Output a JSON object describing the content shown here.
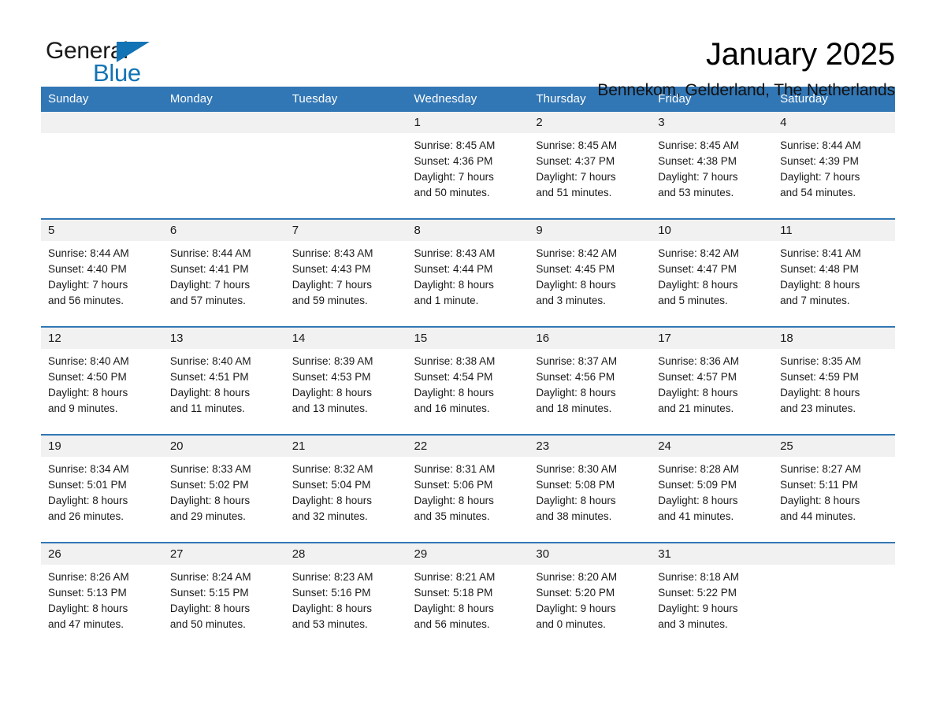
{
  "brand": {
    "name_top": "General",
    "name_bottom": "Blue",
    "accent_color": "#1273b5"
  },
  "header": {
    "title": "January 2025",
    "location": "Bennekom, Gelderland, The Netherlands"
  },
  "theme": {
    "header_blue": "#3277b5",
    "daynum_band": "#f1f1f1",
    "text": "#1a1a1a"
  },
  "weekday_headers": [
    "Sunday",
    "Monday",
    "Tuesday",
    "Wednesday",
    "Thursday",
    "Friday",
    "Saturday"
  ],
  "labels": {
    "sunrise_prefix": "Sunrise:",
    "sunset_prefix": "Sunset:",
    "daylight_prefix": "Daylight:"
  },
  "weeks": [
    [
      {
        "day": "",
        "empty": true
      },
      {
        "day": "",
        "empty": true
      },
      {
        "day": "",
        "empty": true
      },
      {
        "day": "1",
        "sunrise": "Sunrise: 8:45 AM",
        "sunset": "Sunset: 4:36 PM",
        "daylight_line1": "Daylight: 7 hours",
        "daylight_line2": "and 50 minutes."
      },
      {
        "day": "2",
        "sunrise": "Sunrise: 8:45 AM",
        "sunset": "Sunset: 4:37 PM",
        "daylight_line1": "Daylight: 7 hours",
        "daylight_line2": "and 51 minutes."
      },
      {
        "day": "3",
        "sunrise": "Sunrise: 8:45 AM",
        "sunset": "Sunset: 4:38 PM",
        "daylight_line1": "Daylight: 7 hours",
        "daylight_line2": "and 53 minutes."
      },
      {
        "day": "4",
        "sunrise": "Sunrise: 8:44 AM",
        "sunset": "Sunset: 4:39 PM",
        "daylight_line1": "Daylight: 7 hours",
        "daylight_line2": "and 54 minutes."
      }
    ],
    [
      {
        "day": "5",
        "sunrise": "Sunrise: 8:44 AM",
        "sunset": "Sunset: 4:40 PM",
        "daylight_line1": "Daylight: 7 hours",
        "daylight_line2": "and 56 minutes."
      },
      {
        "day": "6",
        "sunrise": "Sunrise: 8:44 AM",
        "sunset": "Sunset: 4:41 PM",
        "daylight_line1": "Daylight: 7 hours",
        "daylight_line2": "and 57 minutes."
      },
      {
        "day": "7",
        "sunrise": "Sunrise: 8:43 AM",
        "sunset": "Sunset: 4:43 PM",
        "daylight_line1": "Daylight: 7 hours",
        "daylight_line2": "and 59 minutes."
      },
      {
        "day": "8",
        "sunrise": "Sunrise: 8:43 AM",
        "sunset": "Sunset: 4:44 PM",
        "daylight_line1": "Daylight: 8 hours",
        "daylight_line2": "and 1 minute."
      },
      {
        "day": "9",
        "sunrise": "Sunrise: 8:42 AM",
        "sunset": "Sunset: 4:45 PM",
        "daylight_line1": "Daylight: 8 hours",
        "daylight_line2": "and 3 minutes."
      },
      {
        "day": "10",
        "sunrise": "Sunrise: 8:42 AM",
        "sunset": "Sunset: 4:47 PM",
        "daylight_line1": "Daylight: 8 hours",
        "daylight_line2": "and 5 minutes."
      },
      {
        "day": "11",
        "sunrise": "Sunrise: 8:41 AM",
        "sunset": "Sunset: 4:48 PM",
        "daylight_line1": "Daylight: 8 hours",
        "daylight_line2": "and 7 minutes."
      }
    ],
    [
      {
        "day": "12",
        "sunrise": "Sunrise: 8:40 AM",
        "sunset": "Sunset: 4:50 PM",
        "daylight_line1": "Daylight: 8 hours",
        "daylight_line2": "and 9 minutes."
      },
      {
        "day": "13",
        "sunrise": "Sunrise: 8:40 AM",
        "sunset": "Sunset: 4:51 PM",
        "daylight_line1": "Daylight: 8 hours",
        "daylight_line2": "and 11 minutes."
      },
      {
        "day": "14",
        "sunrise": "Sunrise: 8:39 AM",
        "sunset": "Sunset: 4:53 PM",
        "daylight_line1": "Daylight: 8 hours",
        "daylight_line2": "and 13 minutes."
      },
      {
        "day": "15",
        "sunrise": "Sunrise: 8:38 AM",
        "sunset": "Sunset: 4:54 PM",
        "daylight_line1": "Daylight: 8 hours",
        "daylight_line2": "and 16 minutes."
      },
      {
        "day": "16",
        "sunrise": "Sunrise: 8:37 AM",
        "sunset": "Sunset: 4:56 PM",
        "daylight_line1": "Daylight: 8 hours",
        "daylight_line2": "and 18 minutes."
      },
      {
        "day": "17",
        "sunrise": "Sunrise: 8:36 AM",
        "sunset": "Sunset: 4:57 PM",
        "daylight_line1": "Daylight: 8 hours",
        "daylight_line2": "and 21 minutes."
      },
      {
        "day": "18",
        "sunrise": "Sunrise: 8:35 AM",
        "sunset": "Sunset: 4:59 PM",
        "daylight_line1": "Daylight: 8 hours",
        "daylight_line2": "and 23 minutes."
      }
    ],
    [
      {
        "day": "19",
        "sunrise": "Sunrise: 8:34 AM",
        "sunset": "Sunset: 5:01 PM",
        "daylight_line1": "Daylight: 8 hours",
        "daylight_line2": "and 26 minutes."
      },
      {
        "day": "20",
        "sunrise": "Sunrise: 8:33 AM",
        "sunset": "Sunset: 5:02 PM",
        "daylight_line1": "Daylight: 8 hours",
        "daylight_line2": "and 29 minutes."
      },
      {
        "day": "21",
        "sunrise": "Sunrise: 8:32 AM",
        "sunset": "Sunset: 5:04 PM",
        "daylight_line1": "Daylight: 8 hours",
        "daylight_line2": "and 32 minutes."
      },
      {
        "day": "22",
        "sunrise": "Sunrise: 8:31 AM",
        "sunset": "Sunset: 5:06 PM",
        "daylight_line1": "Daylight: 8 hours",
        "daylight_line2": "and 35 minutes."
      },
      {
        "day": "23",
        "sunrise": "Sunrise: 8:30 AM",
        "sunset": "Sunset: 5:08 PM",
        "daylight_line1": "Daylight: 8 hours",
        "daylight_line2": "and 38 minutes."
      },
      {
        "day": "24",
        "sunrise": "Sunrise: 8:28 AM",
        "sunset": "Sunset: 5:09 PM",
        "daylight_line1": "Daylight: 8 hours",
        "daylight_line2": "and 41 minutes."
      },
      {
        "day": "25",
        "sunrise": "Sunrise: 8:27 AM",
        "sunset": "Sunset: 5:11 PM",
        "daylight_line1": "Daylight: 8 hours",
        "daylight_line2": "and 44 minutes."
      }
    ],
    [
      {
        "day": "26",
        "sunrise": "Sunrise: 8:26 AM",
        "sunset": "Sunset: 5:13 PM",
        "daylight_line1": "Daylight: 8 hours",
        "daylight_line2": "and 47 minutes."
      },
      {
        "day": "27",
        "sunrise": "Sunrise: 8:24 AM",
        "sunset": "Sunset: 5:15 PM",
        "daylight_line1": "Daylight: 8 hours",
        "daylight_line2": "and 50 minutes."
      },
      {
        "day": "28",
        "sunrise": "Sunrise: 8:23 AM",
        "sunset": "Sunset: 5:16 PM",
        "daylight_line1": "Daylight: 8 hours",
        "daylight_line2": "and 53 minutes."
      },
      {
        "day": "29",
        "sunrise": "Sunrise: 8:21 AM",
        "sunset": "Sunset: 5:18 PM",
        "daylight_line1": "Daylight: 8 hours",
        "daylight_line2": "and 56 minutes."
      },
      {
        "day": "30",
        "sunrise": "Sunrise: 8:20 AM",
        "sunset": "Sunset: 5:20 PM",
        "daylight_line1": "Daylight: 9 hours",
        "daylight_line2": "and 0 minutes."
      },
      {
        "day": "31",
        "sunrise": "Sunrise: 8:18 AM",
        "sunset": "Sunset: 5:22 PM",
        "daylight_line1": "Daylight: 9 hours",
        "daylight_line2": "and 3 minutes."
      },
      {
        "day": "",
        "empty": true
      }
    ]
  ]
}
